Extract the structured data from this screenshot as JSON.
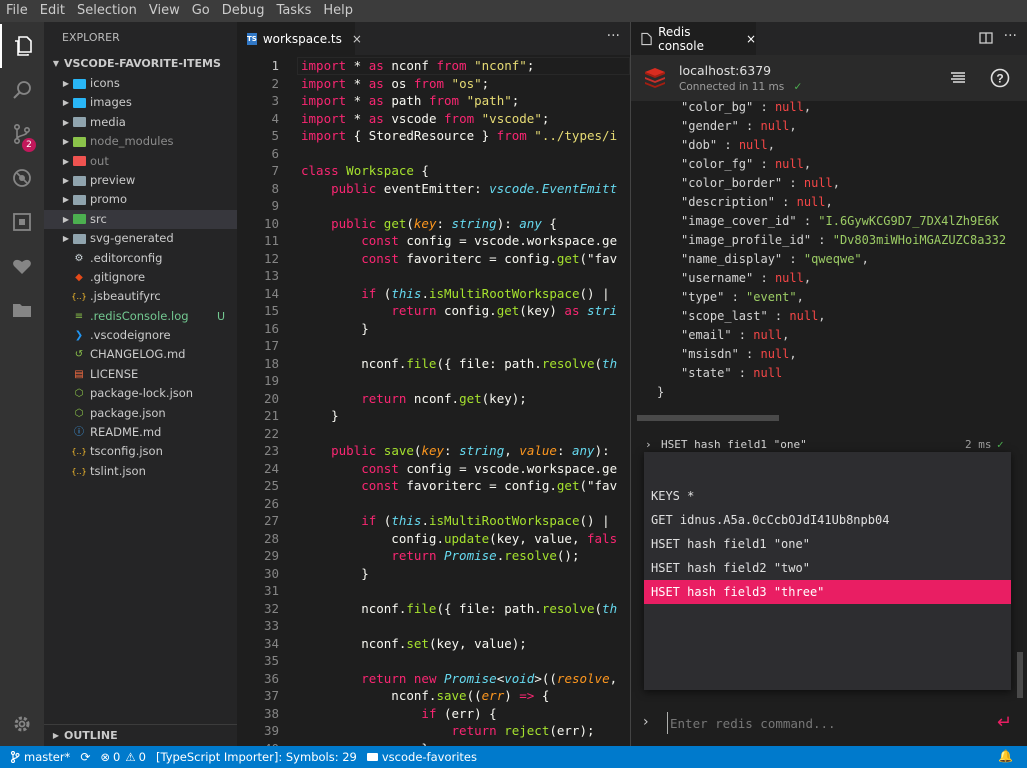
{
  "menu": [
    "File",
    "Edit",
    "Selection",
    "View",
    "Go",
    "Debug",
    "Tasks",
    "Help"
  ],
  "activity": {
    "scm_badge": "2"
  },
  "explorer": {
    "title": "EXPLORER",
    "project": "VSCODE-FAVORITE-ITEMS",
    "outline": "OUTLINE",
    "items": [
      {
        "name": "icons",
        "type": "folder",
        "color": "#29b6f6"
      },
      {
        "name": "images",
        "type": "folder",
        "color": "#29b6f6"
      },
      {
        "name": "media",
        "type": "folder",
        "color": "#90a4ae"
      },
      {
        "name": "node_modules",
        "type": "folder",
        "color": "#8bc34a",
        "dim": true
      },
      {
        "name": "out",
        "type": "folder",
        "color": "#ef5350",
        "dim": true
      },
      {
        "name": "preview",
        "type": "folder",
        "color": "#90a4ae"
      },
      {
        "name": "promo",
        "type": "folder",
        "color": "#90a4ae"
      },
      {
        "name": "src",
        "type": "folder",
        "color": "#4caf50",
        "selected": true
      },
      {
        "name": "svg-generated",
        "type": "folder",
        "color": "#90a4ae"
      },
      {
        "name": ".editorconfig",
        "type": "file",
        "icon": "gear",
        "color": "#cfd8dc"
      },
      {
        "name": ".gitignore",
        "type": "file",
        "icon": "git",
        "color": "#e64a19"
      },
      {
        "name": ".jsbeautifyrc",
        "type": "file",
        "icon": "braces",
        "color": "#fbc02d"
      },
      {
        "name": ".redisConsole.log",
        "type": "file",
        "icon": "lines",
        "color": "#8bc34a",
        "git": "U",
        "modified": true
      },
      {
        "name": ".vscodeignore",
        "type": "file",
        "icon": "vscode",
        "color": "#2196f3"
      },
      {
        "name": "CHANGELOG.md",
        "type": "file",
        "icon": "history",
        "color": "#8bc34a"
      },
      {
        "name": "LICENSE",
        "type": "file",
        "icon": "license",
        "color": "#ff7043"
      },
      {
        "name": "package-lock.json",
        "type": "file",
        "icon": "node",
        "color": "#8bc34a"
      },
      {
        "name": "package.json",
        "type": "file",
        "icon": "node",
        "color": "#8bc34a"
      },
      {
        "name": "README.md",
        "type": "file",
        "icon": "info",
        "color": "#42a5f5"
      },
      {
        "name": "tsconfig.json",
        "type": "file",
        "icon": "braces",
        "color": "#fbc02d"
      },
      {
        "name": "tslint.json",
        "type": "file",
        "icon": "braces",
        "color": "#fbc02d"
      }
    ]
  },
  "editor": {
    "tab": {
      "badge": "TS",
      "label": "workspace.ts",
      "close": "×"
    },
    "more": "···",
    "lines": [
      [
        [
          "k",
          "import"
        ],
        [
          "w",
          " * "
        ],
        [
          "k",
          "as"
        ],
        [
          "w",
          " nconf "
        ],
        [
          "k",
          "from"
        ],
        [
          "s",
          " \"nconf\""
        ],
        [
          "w",
          ";"
        ]
      ],
      [
        [
          "k",
          "import"
        ],
        [
          "w",
          " * "
        ],
        [
          "k",
          "as"
        ],
        [
          "w",
          " os "
        ],
        [
          "k",
          "from"
        ],
        [
          "s",
          " \"os\""
        ],
        [
          "w",
          ";"
        ]
      ],
      [
        [
          "k",
          "import"
        ],
        [
          "w",
          " * "
        ],
        [
          "k",
          "as"
        ],
        [
          "w",
          " path "
        ],
        [
          "k",
          "from"
        ],
        [
          "s",
          " \"path\""
        ],
        [
          "w",
          ";"
        ]
      ],
      [
        [
          "k",
          "import"
        ],
        [
          "w",
          " * "
        ],
        [
          "k",
          "as"
        ],
        [
          "w",
          " vscode "
        ],
        [
          "k",
          "from"
        ],
        [
          "s",
          " \"vscode\""
        ],
        [
          "w",
          ";"
        ]
      ],
      [
        [
          "k",
          "import"
        ],
        [
          "w",
          " { StoredResource } "
        ],
        [
          "k",
          "from"
        ],
        [
          "s",
          " \"../types/i"
        ]
      ],
      [],
      [
        [
          "k",
          "class"
        ],
        [
          "f",
          " Workspace"
        ],
        [
          "w",
          " {"
        ]
      ],
      [
        [
          "w",
          "    "
        ],
        [
          "k",
          "public"
        ],
        [
          "w",
          " eventEmitter: "
        ],
        [
          "t",
          "vscode.EventEmitt"
        ]
      ],
      [],
      [
        [
          "w",
          "    "
        ],
        [
          "k",
          "public"
        ],
        [
          "f",
          " get"
        ],
        [
          "w",
          "("
        ],
        [
          "i",
          "key"
        ],
        [
          "w",
          ": "
        ],
        [
          "t",
          "string"
        ],
        [
          "w",
          "): "
        ],
        [
          "t",
          "any"
        ],
        [
          "w",
          " {"
        ]
      ],
      [
        [
          "w",
          "        "
        ],
        [
          "k",
          "const"
        ],
        [
          "w",
          " config = vscode.workspace.ge"
        ]
      ],
      [
        [
          "w",
          "        "
        ],
        [
          "k",
          "const"
        ],
        [
          "w",
          " favoriterc = config."
        ],
        [
          "f",
          "get"
        ],
        [
          "w",
          "(\"fav"
        ]
      ],
      [],
      [
        [
          "w",
          "        "
        ],
        [
          "k",
          "if"
        ],
        [
          "w",
          " ("
        ],
        [
          "th",
          "this"
        ],
        [
          "w",
          "."
        ],
        [
          "f",
          "isMultiRootWorkspace"
        ],
        [
          "w",
          "() |"
        ]
      ],
      [
        [
          "w",
          "            "
        ],
        [
          "k",
          "return"
        ],
        [
          "w",
          " config."
        ],
        [
          "f",
          "get"
        ],
        [
          "w",
          "(key) "
        ],
        [
          "k",
          "as"
        ],
        [
          "t",
          " stri"
        ]
      ],
      [
        [
          "w",
          "        }"
        ]
      ],
      [],
      [
        [
          "w",
          "        nconf."
        ],
        [
          "f",
          "file"
        ],
        [
          "w",
          "({ file: path."
        ],
        [
          "f",
          "resolve"
        ],
        [
          "w",
          "("
        ],
        [
          "th",
          "th"
        ]
      ],
      [],
      [
        [
          "w",
          "        "
        ],
        [
          "k",
          "return"
        ],
        [
          "w",
          " nconf."
        ],
        [
          "f",
          "get"
        ],
        [
          "w",
          "(key);"
        ]
      ],
      [
        [
          "w",
          "    }"
        ]
      ],
      [],
      [
        [
          "w",
          "    "
        ],
        [
          "k",
          "public"
        ],
        [
          "f",
          " save"
        ],
        [
          "w",
          "("
        ],
        [
          "i",
          "key"
        ],
        [
          "w",
          ": "
        ],
        [
          "t",
          "string"
        ],
        [
          "w",
          ", "
        ],
        [
          "i",
          "value"
        ],
        [
          "w",
          ": "
        ],
        [
          "t",
          "any"
        ],
        [
          "w",
          "):"
        ]
      ],
      [
        [
          "w",
          "        "
        ],
        [
          "k",
          "const"
        ],
        [
          "w",
          " config = vscode.workspace.ge"
        ]
      ],
      [
        [
          "w",
          "        "
        ],
        [
          "k",
          "const"
        ],
        [
          "w",
          " favoriterc = config."
        ],
        [
          "f",
          "get"
        ],
        [
          "w",
          "(\"fav"
        ]
      ],
      [],
      [
        [
          "w",
          "        "
        ],
        [
          "k",
          "if"
        ],
        [
          "w",
          " ("
        ],
        [
          "th",
          "this"
        ],
        [
          "w",
          "."
        ],
        [
          "f",
          "isMultiRootWorkspace"
        ],
        [
          "w",
          "() |"
        ]
      ],
      [
        [
          "w",
          "            config."
        ],
        [
          "f",
          "update"
        ],
        [
          "w",
          "(key, value, "
        ],
        [
          "k",
          "fals"
        ]
      ],
      [
        [
          "w",
          "            "
        ],
        [
          "k",
          "return"
        ],
        [
          "t",
          " Promise"
        ],
        [
          "w",
          "."
        ],
        [
          "f",
          "resolve"
        ],
        [
          "w",
          "();"
        ]
      ],
      [
        [
          "w",
          "        }"
        ]
      ],
      [],
      [
        [
          "w",
          "        nconf."
        ],
        [
          "f",
          "file"
        ],
        [
          "w",
          "({ file: path."
        ],
        [
          "f",
          "resolve"
        ],
        [
          "w",
          "("
        ],
        [
          "th",
          "th"
        ]
      ],
      [],
      [
        [
          "w",
          "        nconf."
        ],
        [
          "f",
          "set"
        ],
        [
          "w",
          "(key, value);"
        ]
      ],
      [],
      [
        [
          "w",
          "        "
        ],
        [
          "k",
          "return"
        ],
        [
          "k",
          " new"
        ],
        [
          "t",
          " Promise"
        ],
        [
          "w",
          "<"
        ],
        [
          "t",
          "void"
        ],
        [
          "w",
          ">(("
        ],
        [
          "i",
          "resolve"
        ],
        [
          "w",
          ","
        ]
      ],
      [
        [
          "w",
          "            nconf."
        ],
        [
          "f",
          "save"
        ],
        [
          "w",
          "(("
        ],
        [
          "i",
          "err"
        ],
        [
          "w",
          ") "
        ],
        [
          "k",
          "=>"
        ],
        [
          "w",
          " {"
        ]
      ],
      [
        [
          "w",
          "                "
        ],
        [
          "k",
          "if"
        ],
        [
          "w",
          " (err) {"
        ]
      ],
      [
        [
          "w",
          "                    "
        ],
        [
          "k",
          "return"
        ],
        [
          "f",
          " reject"
        ],
        [
          "w",
          "(err);"
        ]
      ],
      [
        [
          "w",
          "                }"
        ]
      ]
    ]
  },
  "redis": {
    "tab": {
      "label": "Redis console",
      "close": "×"
    },
    "host": "localhost:6379",
    "connected": "Connected in 11 ms",
    "json_lines": [
      [
        [
          "k",
          "\"color_bg\""
        ],
        [
          "p",
          " : "
        ],
        [
          "n",
          "null"
        ],
        [
          "p",
          ","
        ]
      ],
      [
        [
          "k",
          "\"gender\""
        ],
        [
          "p",
          " : "
        ],
        [
          "n",
          "null"
        ],
        [
          "p",
          ","
        ]
      ],
      [
        [
          "k",
          "\"dob\""
        ],
        [
          "p",
          " : "
        ],
        [
          "n",
          "null"
        ],
        [
          "p",
          ","
        ]
      ],
      [
        [
          "k",
          "\"color_fg\""
        ],
        [
          "p",
          " : "
        ],
        [
          "n",
          "null"
        ],
        [
          "p",
          ","
        ]
      ],
      [
        [
          "k",
          "\"color_border\""
        ],
        [
          "p",
          " : "
        ],
        [
          "n",
          "null"
        ],
        [
          "p",
          ","
        ]
      ],
      [
        [
          "k",
          "\"description\""
        ],
        [
          "p",
          " : "
        ],
        [
          "n",
          "null"
        ],
        [
          "p",
          ","
        ]
      ],
      [
        [
          "k",
          "\"image_cover_id\""
        ],
        [
          "p",
          " : "
        ],
        [
          "s",
          "\"I.6GywKCG9D7_7DX4lZh9E6K"
        ]
      ],
      [
        [
          "k",
          "\"image_profile_id\""
        ],
        [
          "p",
          " : "
        ],
        [
          "s",
          "\"Dv803miWHoiMGAZUZC8a332"
        ]
      ],
      [
        [
          "k",
          "\"name_display\""
        ],
        [
          "p",
          " : "
        ],
        [
          "s",
          "\"qweqwe\""
        ],
        [
          "p",
          ","
        ]
      ],
      [
        [
          "k",
          "\"username\""
        ],
        [
          "p",
          " : "
        ],
        [
          "n",
          "null"
        ],
        [
          "p",
          ","
        ]
      ],
      [
        [
          "k",
          "\"type\""
        ],
        [
          "p",
          " : "
        ],
        [
          "s",
          "\"event\""
        ],
        [
          "p",
          ","
        ]
      ],
      [
        [
          "k",
          "\"scope_last\""
        ],
        [
          "p",
          " : "
        ],
        [
          "n",
          "null"
        ],
        [
          "p",
          ","
        ]
      ],
      [
        [
          "k",
          "\"email\""
        ],
        [
          "p",
          " : "
        ],
        [
          "n",
          "null"
        ],
        [
          "p",
          ","
        ]
      ],
      [
        [
          "k",
          "\"msisdn\""
        ],
        [
          "p",
          " : "
        ],
        [
          "n",
          "null"
        ],
        [
          "p",
          ","
        ]
      ],
      [
        [
          "k",
          "\"state\""
        ],
        [
          "p",
          " : "
        ],
        [
          "n",
          "null"
        ]
      ]
    ],
    "json_close": "}",
    "history": {
      "cmd": "HSET hash field1 \"one\"",
      "time": "2 ms"
    },
    "suggestions": [
      "KEYS *",
      "GET idnus.A5a.0cCcbOJdI41Ub8npb04",
      "HSET hash field1 \"one\"",
      "HSET hash field2 \"two\"",
      "HSET hash field3 \"three\""
    ],
    "selected_index": 4,
    "input_placeholder": "Enter redis command...",
    "accent": "#e91e63"
  },
  "status": {
    "branch": "master*",
    "errors": "0",
    "warnings": "0",
    "importer": "[TypeScript Importer]: Symbols: 29",
    "folder": "vscode-favorites"
  }
}
